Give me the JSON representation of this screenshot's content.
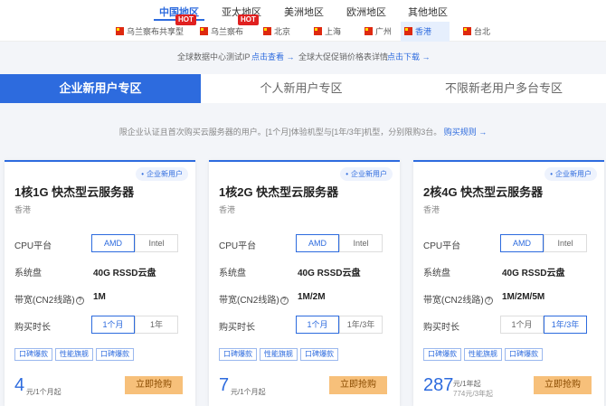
{
  "region_tabs": [
    {
      "label": "中国地区",
      "active": true
    },
    {
      "label": "亚太地区",
      "active": false
    },
    {
      "label": "美洲地区",
      "active": false
    },
    {
      "label": "欧洲地区",
      "active": false
    },
    {
      "label": "其他地区",
      "active": false
    }
  ],
  "cities": [
    {
      "label": "乌兰察布共享型",
      "hot": "HOT"
    },
    {
      "label": "乌兰察布",
      "hot": "HOT"
    },
    {
      "label": "北京",
      "hot": ""
    },
    {
      "label": "上海",
      "hot": ""
    },
    {
      "label": "广州",
      "hot": ""
    },
    {
      "label": "香港",
      "hot": "",
      "active": true
    },
    {
      "label": "台北",
      "hot": ""
    }
  ],
  "speed_test": {
    "text1": "全球数据中心测试IP",
    "link1": "点击查看 →",
    "text2": "全球大促促销价格表详情",
    "link2": "点击下载 →"
  },
  "zone_tabs": [
    {
      "label": "企业新用户专区",
      "active": true
    },
    {
      "label": "个人新用户专区",
      "active": false
    },
    {
      "label": "不限新老用户多台专区",
      "active": false
    }
  ],
  "notice": {
    "text": "限企业认证且首次购买云服务器的用户。[1个月]体验机型与[1年/3年]机型，分别限购3台。",
    "link": "购买规则 →"
  },
  "labels": {
    "cpu": "CPU平台",
    "disk": "系统盘",
    "bandwidth": "带宽(CN2线路)",
    "duration": "购买时长",
    "help": "?"
  },
  "cards": [
    {
      "badge": "企业新用户",
      "title": "1核1G 快杰型云服务器",
      "region": "香港",
      "cpu_options": [
        "AMD",
        "Intel"
      ],
      "disk": "40G RSSD云盘",
      "bandwidth": "1M",
      "durations": [
        "1个月",
        "1年"
      ],
      "tags": [
        "口碑爆款",
        "性能旗舰",
        "口碑爆款"
      ],
      "price": "4",
      "price_unit": "元/1个月起",
      "price_sub": "",
      "buy": "立即抢购"
    },
    {
      "badge": "企业新用户",
      "title": "1核2G 快杰型云服务器",
      "region": "香港",
      "cpu_options": [
        "AMD",
        "Intel"
      ],
      "disk": "40G RSSD云盘",
      "bandwidth": "1M/2M",
      "durations": [
        "1个月",
        "1年/3年"
      ],
      "tags": [
        "口碑爆款",
        "性能旗舰",
        "口碑爆款"
      ],
      "price": "7",
      "price_unit": "元/1个月起",
      "price_sub": "",
      "buy": "立即抢购"
    },
    {
      "badge": "企业新用户",
      "title": "2核4G 快杰型云服务器",
      "region": "香港",
      "cpu_options": [
        "AMD",
        "Intel"
      ],
      "disk": "40G RSSD云盘",
      "bandwidth": "1M/2M/5M",
      "durations": [
        "1个月",
        "1年/3年"
      ],
      "tags": [
        "口碑爆款",
        "性能旗舰",
        "口碑爆款"
      ],
      "price": "287",
      "price_unit": "元/1年起",
      "price_sub": "774元/3年起",
      "buy": "立即抢购"
    }
  ]
}
